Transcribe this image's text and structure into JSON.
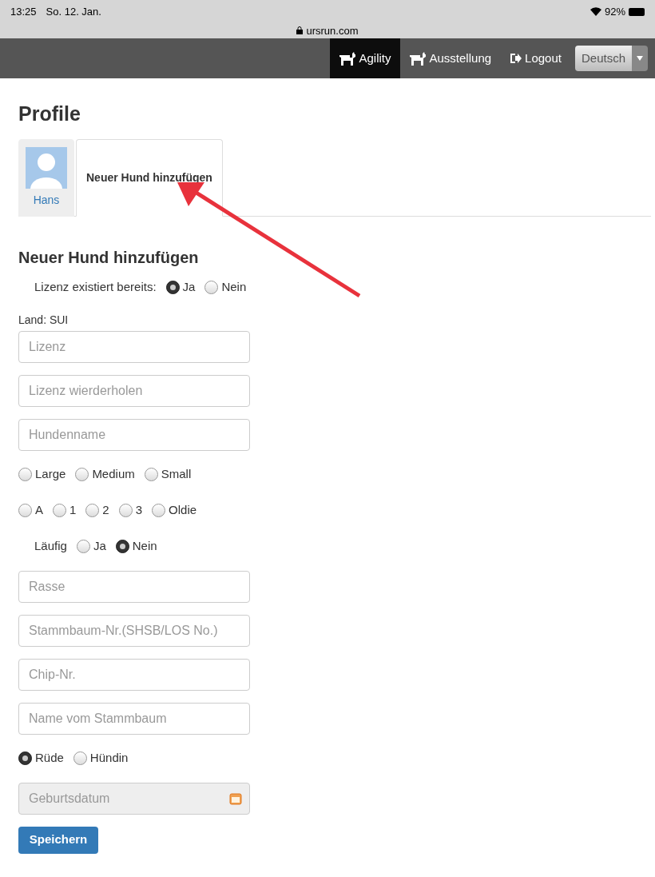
{
  "status_bar": {
    "time": "13:25",
    "date": "So. 12. Jan.",
    "url": "ursrun.com",
    "battery": "92%"
  },
  "nav": {
    "items": [
      {
        "label": "Agility",
        "kind": "dog",
        "selected": true
      },
      {
        "label": "Ausstellung",
        "kind": "dog",
        "selected": false
      },
      {
        "label": "Logout",
        "kind": "logout",
        "selected": false
      }
    ],
    "language": "Deutsch"
  },
  "page_title": "Profile",
  "tabs": [
    {
      "label": "Hans",
      "kind": "avatar",
      "selected": false
    },
    {
      "label": "Neuer Hund hinzufügen",
      "kind": "text",
      "selected": true
    }
  ],
  "form": {
    "title": "Neuer Hund hinzufügen",
    "items": [
      {
        "kind": "radio_group",
        "label": "Lizenz existiert bereits:",
        "options": [
          {
            "label": "Ja",
            "selected": true
          },
          {
            "label": "Nein",
            "selected": false
          }
        ]
      },
      {
        "kind": "note",
        "text": "Land: SUI"
      },
      {
        "kind": "field",
        "placeholder": "Lizenz"
      },
      {
        "kind": "field",
        "placeholder": "Lizenz wierderholen"
      },
      {
        "kind": "field",
        "placeholder": "Hundenname"
      },
      {
        "kind": "radio_group",
        "options": [
          {
            "label": "Large",
            "selected": false
          },
          {
            "label": "Medium",
            "selected": false
          },
          {
            "label": "Small",
            "selected": false
          }
        ]
      },
      {
        "kind": "radio_group",
        "options": [
          {
            "label": "A",
            "selected": false
          },
          {
            "label": "1",
            "selected": false
          },
          {
            "label": "2",
            "selected": false
          },
          {
            "label": "3",
            "selected": false
          },
          {
            "label": "Oldie",
            "selected": false
          }
        ]
      },
      {
        "kind": "radio_group",
        "label": "Läufig",
        "options": [
          {
            "label": "Ja",
            "selected": false
          },
          {
            "label": "Nein",
            "selected": true
          }
        ]
      },
      {
        "kind": "field",
        "placeholder": "Rasse"
      },
      {
        "kind": "field",
        "placeholder": "Stammbaum-Nr.(SHSB/LOS No.)"
      },
      {
        "kind": "field",
        "placeholder": "Chip-Nr."
      },
      {
        "kind": "field",
        "placeholder": "Name vom Stammbaum"
      },
      {
        "kind": "radio_group",
        "options": [
          {
            "label": "Rüde",
            "selected": true
          },
          {
            "label": "Hündin",
            "selected": false
          }
        ]
      },
      {
        "kind": "date_field",
        "placeholder": "Geburtsdatum"
      }
    ],
    "submit": "Speichern"
  }
}
